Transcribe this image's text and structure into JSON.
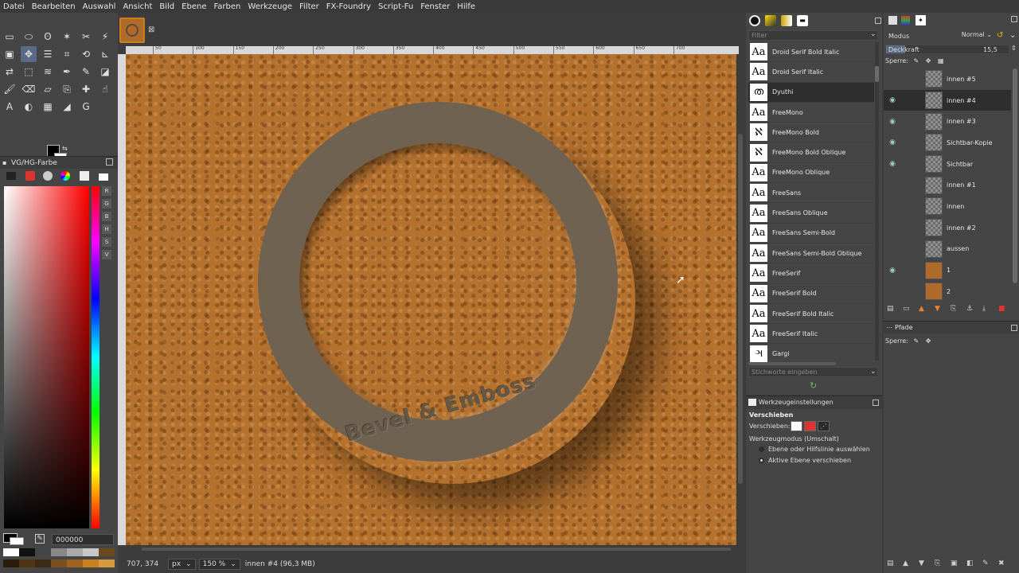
{
  "menu": [
    "Datei",
    "Bearbeiten",
    "Auswahl",
    "Ansicht",
    "Bild",
    "Ebene",
    "Farben",
    "Werkzeuge",
    "Filter",
    "FX-Foundry",
    "Script-Fu",
    "Fenster",
    "Hilfe"
  ],
  "toolbox": {
    "tools": [
      {
        "name": "rect-select-icon",
        "glyph": "▭"
      },
      {
        "name": "ellipse-select-icon",
        "glyph": "⬭"
      },
      {
        "name": "lasso-icon",
        "glyph": "ʘ"
      },
      {
        "name": "fuzzy-select-icon",
        "glyph": "✶"
      },
      {
        "name": "scissors-icon",
        "glyph": "✂"
      },
      {
        "name": "wand-icon",
        "glyph": "⚡"
      },
      {
        "name": "foreground-select-icon",
        "glyph": "▣"
      },
      {
        "name": "move-icon",
        "glyph": "✥",
        "active": true
      },
      {
        "name": "align-icon",
        "glyph": "☰"
      },
      {
        "name": "crop-icon",
        "glyph": "⌗"
      },
      {
        "name": "transform-icon",
        "glyph": "⟲"
      },
      {
        "name": "measure-icon",
        "glyph": "⊾"
      },
      {
        "name": "flip-icon",
        "glyph": "⇄"
      },
      {
        "name": "cage-icon",
        "glyph": "⬚"
      },
      {
        "name": "warp-icon",
        "glyph": "≋"
      },
      {
        "name": "paths-icon",
        "glyph": "✒"
      },
      {
        "name": "pencil-icon",
        "glyph": "✎"
      },
      {
        "name": "bucket-icon",
        "glyph": "◪"
      },
      {
        "name": "brush-icon",
        "glyph": "🖌"
      },
      {
        "name": "airbrush-icon",
        "glyph": "⌫"
      },
      {
        "name": "eraser-icon",
        "glyph": "▱"
      },
      {
        "name": "clone-icon",
        "glyph": "⎘"
      },
      {
        "name": "heal-icon",
        "glyph": "✚"
      },
      {
        "name": "smudge-icon",
        "glyph": "☝"
      },
      {
        "name": "text-icon",
        "glyph": "A"
      },
      {
        "name": "dodge-icon",
        "glyph": "◐"
      },
      {
        "name": "color-picker-icon",
        "glyph": "▦"
      },
      {
        "name": "gradient-icon",
        "glyph": "◢"
      },
      {
        "name": "gmic-icon",
        "glyph": "G"
      }
    ]
  },
  "fg_dock": {
    "title": "VG/HG-Farbe",
    "hex": "000000",
    "modes": [
      "R",
      "G",
      "B",
      "H",
      "S",
      "V"
    ]
  },
  "canvas": {
    "ruler_marks": [
      "50",
      "100",
      "150",
      "200",
      "250",
      "300",
      "350",
      "400",
      "450",
      "500",
      "550",
      "600",
      "650",
      "700"
    ],
    "embossed_text": "Bevel & Emboss",
    "texture_color": "#b5712e",
    "ring_color": "#6f6250"
  },
  "status": {
    "coords": "707, 374",
    "unit": "px",
    "zoom": "150 %",
    "layer_info": "innen #4 (96,3 MB)"
  },
  "fonts": {
    "filter_placeholder": "Filter",
    "search_placeholder": "Stichworte eingeben",
    "items": [
      {
        "preview": "Aa",
        "name": "Droid Serif Bold Italic"
      },
      {
        "preview": "Aa",
        "name": "Droid Serif Italic"
      },
      {
        "preview": "ത",
        "name": "Dyuthi",
        "selected": true
      },
      {
        "preview": "Aa",
        "name": "FreeMono"
      },
      {
        "preview": "ℵ",
        "name": "FreeMono Bold"
      },
      {
        "preview": "ℵ",
        "name": "FreeMono Bold Oblique"
      },
      {
        "preview": "Aa",
        "name": "FreeMono Oblique"
      },
      {
        "preview": "Aa",
        "name": "FreeSans"
      },
      {
        "preview": "Aa",
        "name": "FreeSans Oblique"
      },
      {
        "preview": "Aa",
        "name": "FreeSans Semi-Bold"
      },
      {
        "preview": "Aa",
        "name": "FreeSans Semi-Bold Oblique"
      },
      {
        "preview": "Aa",
        "name": "FreeSerif"
      },
      {
        "preview": "Aa",
        "name": "FreeSerif Bold"
      },
      {
        "preview": "Aa",
        "name": "FreeSerif Bold Italic"
      },
      {
        "preview": "Aa",
        "name": "FreeSerif Italic"
      },
      {
        "preview": "ઞ",
        "name": "Gargi"
      }
    ]
  },
  "tool_options": {
    "title": "Werkzeugeinstellungen",
    "tool_name": "Verschieben",
    "move_label": "Verschieben:",
    "mode_label": "Werkzeugmodus (Umschalt)",
    "options": [
      {
        "label": "Ebene oder Hilfslinie auswählen",
        "selected": false
      },
      {
        "label": "Aktive Ebene verschieben",
        "selected": true
      }
    ]
  },
  "layers": {
    "mode_label": "Modus",
    "mode_value": "Normal",
    "opacity_label": "Deckkraft",
    "opacity_value": "15,5",
    "lock_label": "Sperre:",
    "items": [
      {
        "name": "innen #5",
        "visible": false
      },
      {
        "name": "innen #4",
        "visible": true,
        "selected": true
      },
      {
        "name": "innen #3",
        "visible": true
      },
      {
        "name": "Sichtbar-Kopie",
        "visible": true
      },
      {
        "name": "Sichtbar",
        "visible": true
      },
      {
        "name": "innen #1",
        "visible": false
      },
      {
        "name": "innen",
        "visible": false
      },
      {
        "name": "innen #2",
        "visible": false
      },
      {
        "name": "aussen",
        "visible": false
      },
      {
        "name": "1",
        "visible": true,
        "bg": true
      },
      {
        "name": "2",
        "visible": false,
        "bg": true
      }
    ],
    "paths_title": "Pfade",
    "paths_lock_label": "Sperre:"
  }
}
